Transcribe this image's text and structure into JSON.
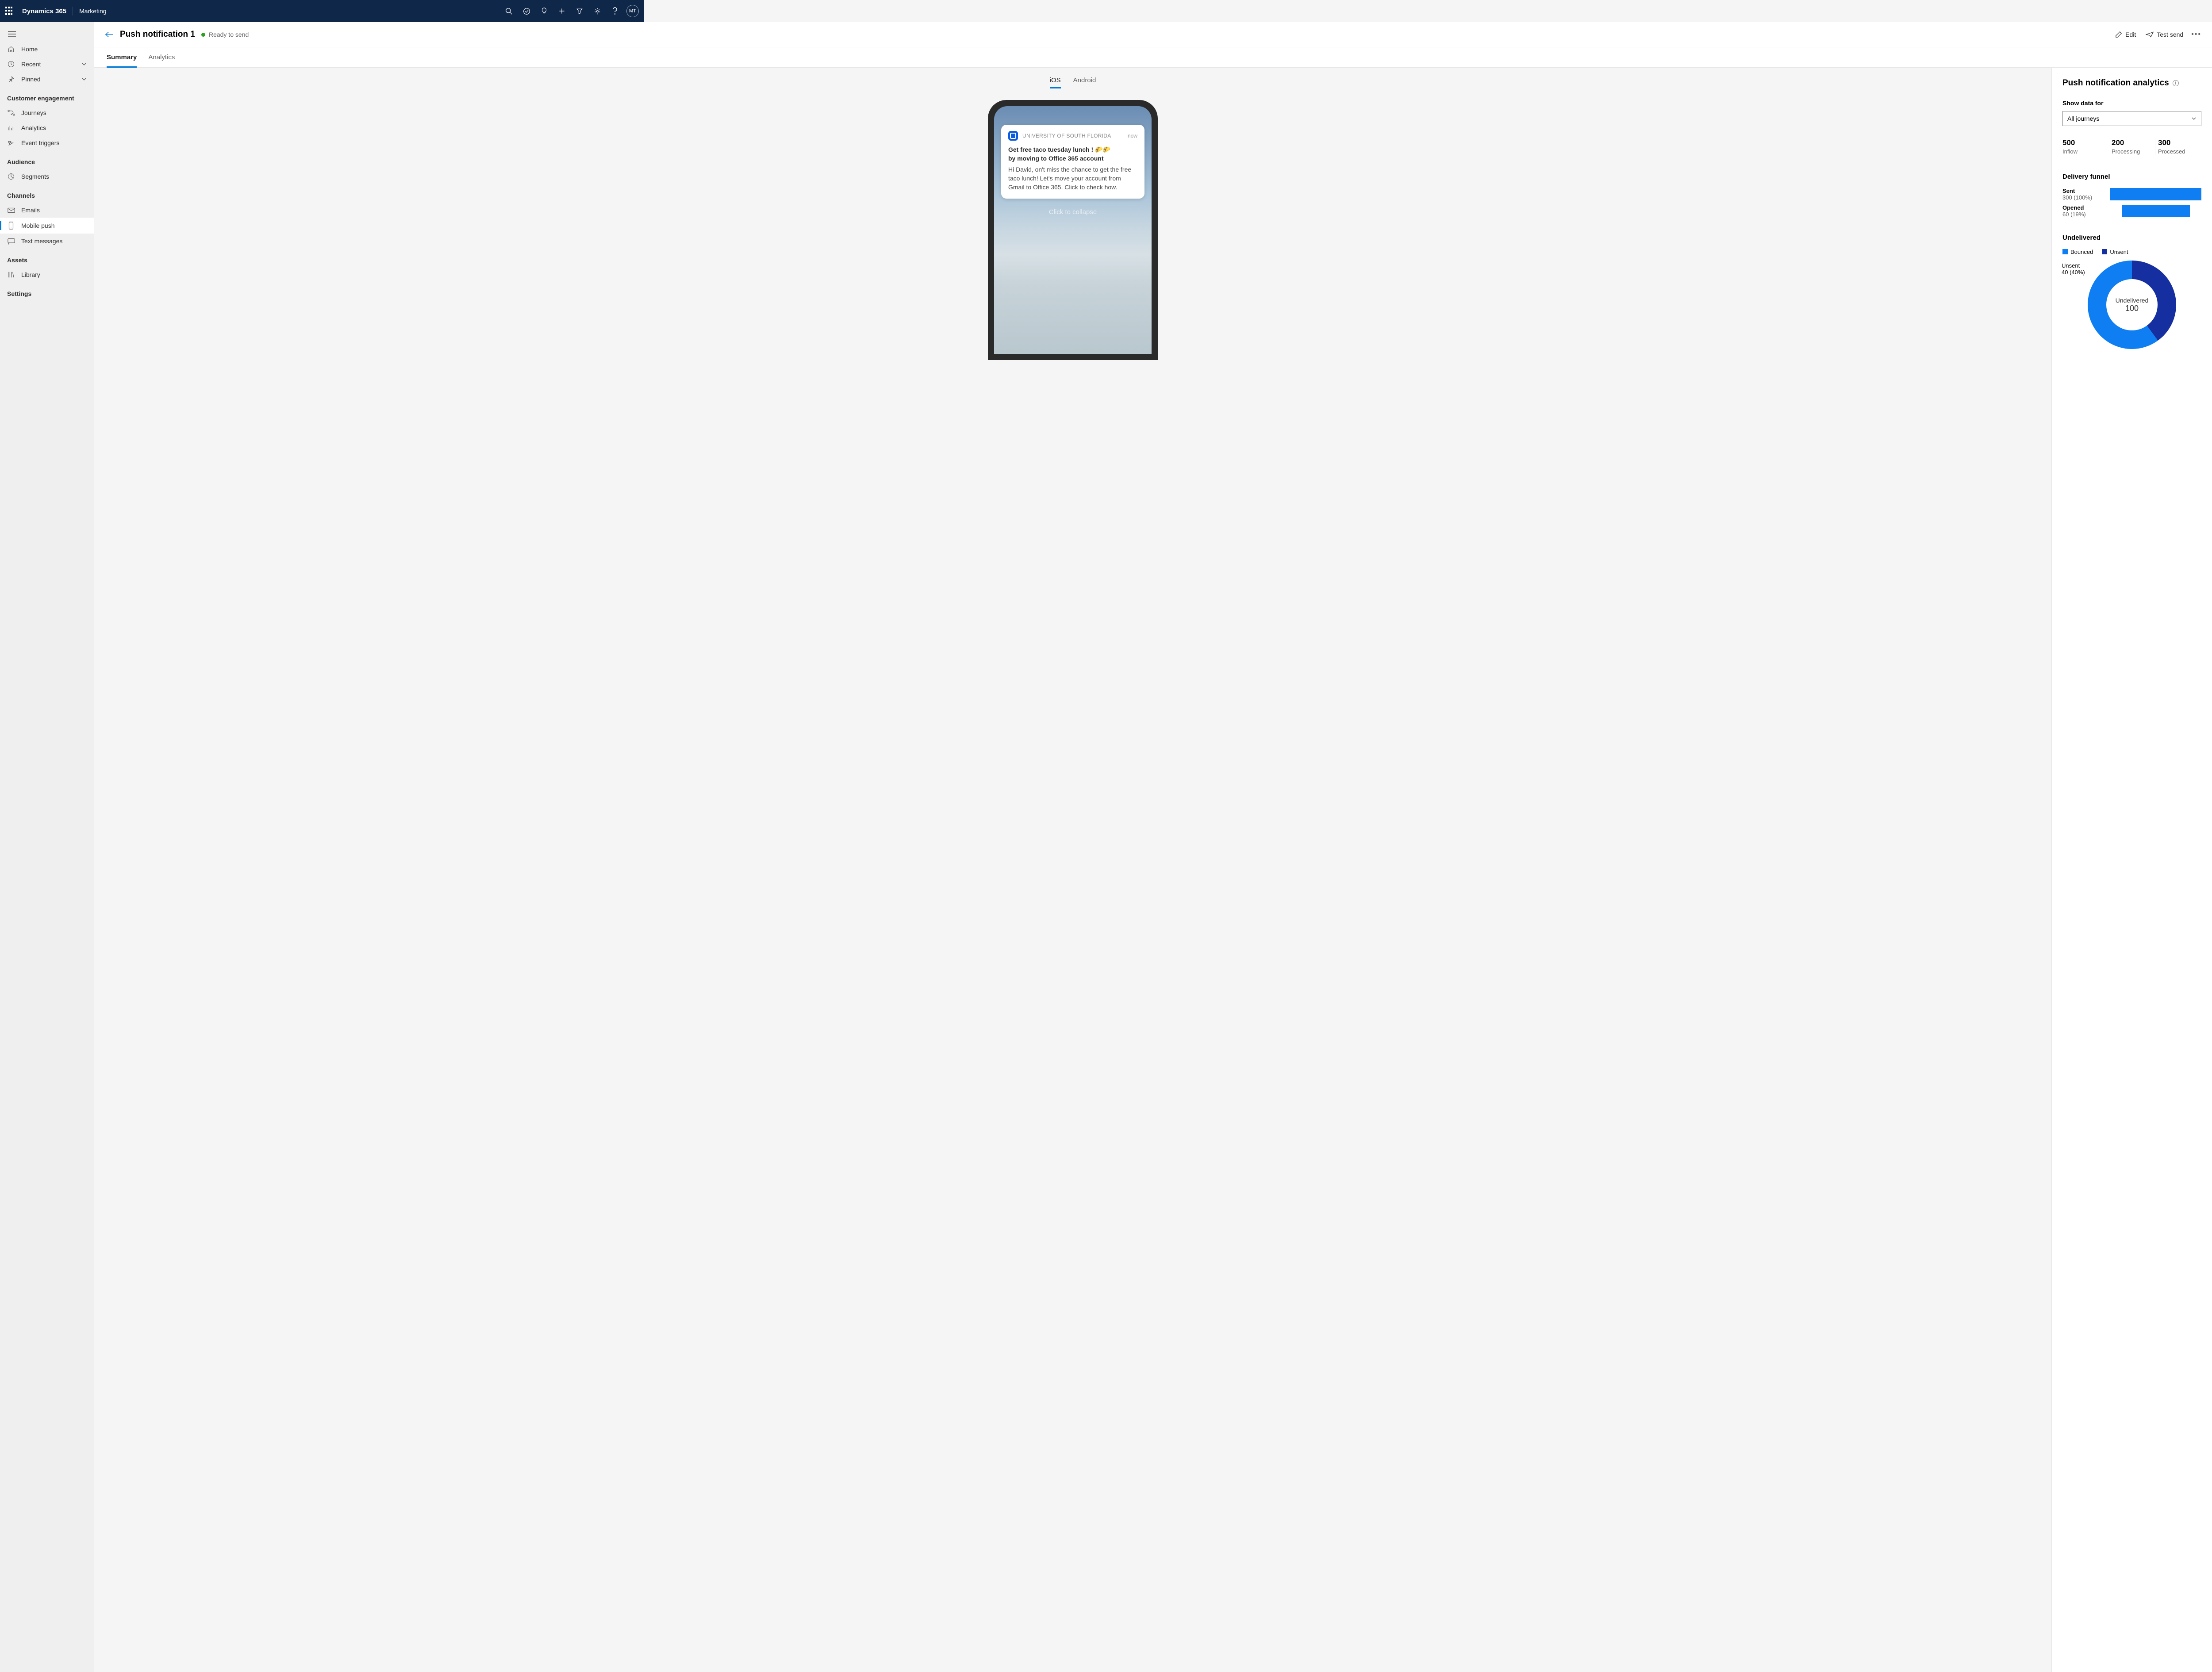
{
  "topbar": {
    "brand": "Dynamics 365",
    "area": "Marketing",
    "avatar": "MT"
  },
  "sidebar": {
    "home": "Home",
    "recent": "Recent",
    "pinned": "Pinned",
    "groups": [
      {
        "label": "Customer engagement",
        "items": [
          "Journeys",
          "Analytics",
          "Event triggers"
        ]
      },
      {
        "label": "Audience",
        "items": [
          "Segments"
        ]
      },
      {
        "label": "Channels",
        "items": [
          "Emails",
          "Mobile push",
          "Text messages"
        ]
      },
      {
        "label": "Assets",
        "items": [
          "Library"
        ]
      },
      {
        "label": "Settings",
        "items": []
      }
    ],
    "selected": "Mobile push"
  },
  "page": {
    "title": "Push notification 1",
    "status": "Ready to send",
    "actions": {
      "edit": "Edit",
      "testsend": "Test send"
    },
    "tabs": [
      "Summary",
      "Analytics"
    ],
    "preview_tabs": [
      "iOS",
      "Android"
    ],
    "collapse": "Click to collapse"
  },
  "notification": {
    "app": "UNIVERSITY OF SOUTH FLORIDA",
    "time": "now",
    "title_line1": "Get free taco tuesday lunch ! 🌮🌮",
    "title_line2": "by moving to Office 365 account",
    "body": "Hi David, on't miss the chance to get the free taco lunch! Let's move your account from Gmail to Office 365. Click to check how."
  },
  "analytics": {
    "title": "Push notification analytics",
    "filter_label": "Show data for",
    "filter_value": "All journeys",
    "metrics": [
      {
        "value": "500",
        "label": "Inflow"
      },
      {
        "value": "200",
        "label": "Processing"
      },
      {
        "value": "300",
        "label": "Processed"
      }
    ],
    "funnel": {
      "title": "Delivery funnel",
      "rows": [
        {
          "label": "Sent",
          "detail": "300 (100%)",
          "pct": 100
        },
        {
          "label": "Opened",
          "detail": "60 (19%)",
          "pct": 75
        }
      ]
    },
    "undelivered": {
      "title": "Undelivered",
      "legend": [
        {
          "label": "Bounced",
          "color": "#0e7ef2"
        },
        {
          "label": "Unsent",
          "color": "#152ea0"
        }
      ],
      "slice_label": "Unsent",
      "slice_detail": "40 (40%)",
      "center_label": "Undelivered",
      "center_value": "100"
    }
  },
  "chart_data": [
    {
      "type": "bar",
      "title": "Delivery funnel",
      "categories": [
        "Sent",
        "Opened"
      ],
      "values": [
        300,
        60
      ],
      "percentages": [
        100,
        19
      ]
    },
    {
      "type": "pie",
      "title": "Undelivered",
      "total": 100,
      "series": [
        {
          "name": "Unsent",
          "value": 40
        },
        {
          "name": "Bounced",
          "value": 60
        }
      ]
    }
  ]
}
